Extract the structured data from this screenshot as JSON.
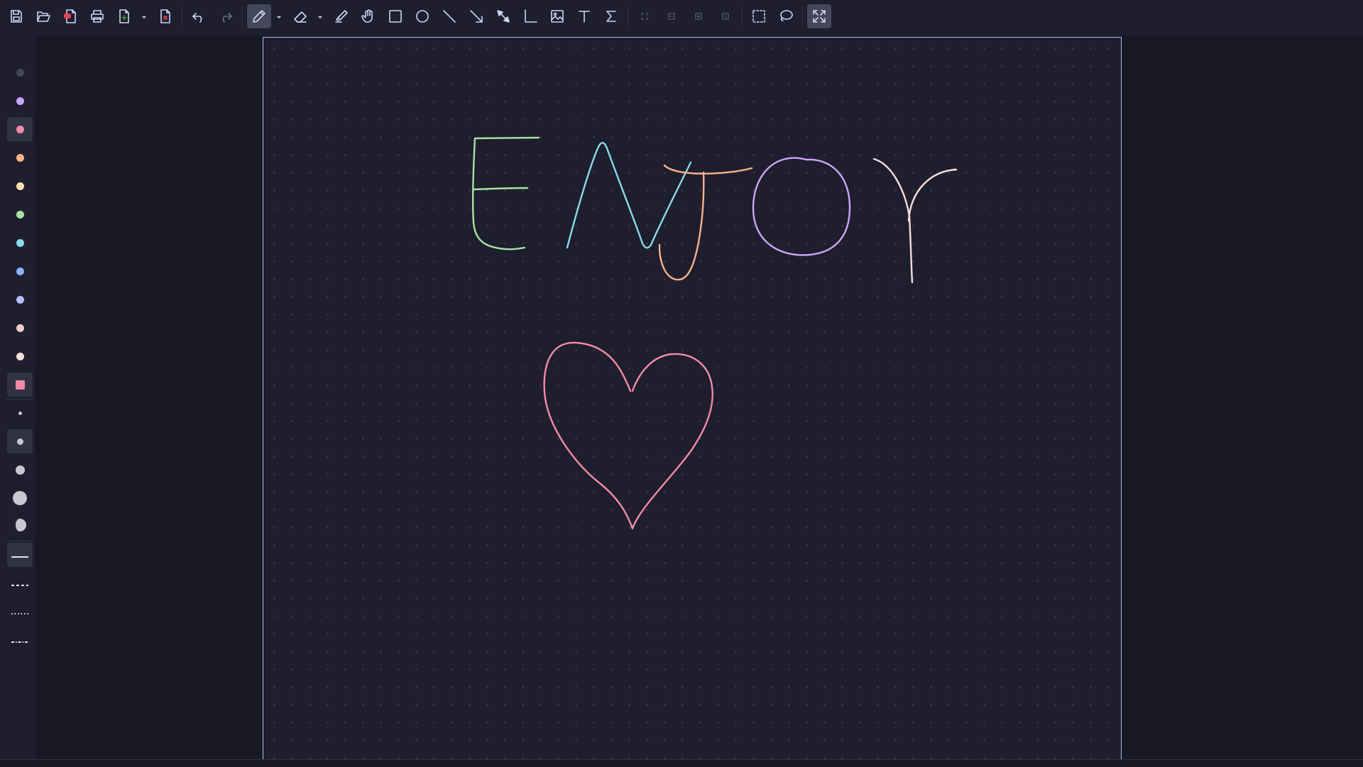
{
  "window": {
    "width": 1920,
    "height": 1080
  },
  "toolbar": {
    "buttons": [
      {
        "name": "save-button",
        "icon": "save-icon"
      },
      {
        "name": "open-button",
        "icon": "folder-open-icon"
      },
      {
        "name": "annotate-pdf-button",
        "icon": "pdf-icon"
      },
      {
        "name": "print-button",
        "icon": "printer-icon"
      },
      {
        "name": "new-page-button",
        "icon": "add-page-icon"
      },
      {
        "name": "delete-page-button",
        "icon": "delete-page-icon"
      },
      {
        "name": "undo-button",
        "icon": "undo-icon"
      },
      {
        "name": "redo-button",
        "icon": "redo-icon"
      },
      {
        "name": "pen-tool-button",
        "icon": "pen-icon",
        "active": true
      },
      {
        "name": "eraser-tool-button",
        "icon": "eraser-icon"
      },
      {
        "name": "highlighter-tool-button",
        "icon": "highlighter-icon"
      },
      {
        "name": "hand-tool-button",
        "icon": "hand-icon"
      },
      {
        "name": "rectangle-tool-button",
        "icon": "rectangle-icon"
      },
      {
        "name": "ellipse-tool-button",
        "icon": "ellipse-icon"
      },
      {
        "name": "line-tool-button",
        "icon": "line-icon"
      },
      {
        "name": "arrow-tool-button",
        "icon": "arrow-icon"
      },
      {
        "name": "double-arrow-tool-button",
        "icon": "double-arrow-icon"
      },
      {
        "name": "axis-tool-button",
        "icon": "axis-icon"
      },
      {
        "name": "image-tool-button",
        "icon": "image-icon"
      },
      {
        "name": "text-tool-button",
        "icon": "text-icon"
      },
      {
        "name": "latex-tool-button",
        "icon": "sigma-icon"
      },
      {
        "name": "zoom-fit-button",
        "icon": "fit-icon"
      },
      {
        "name": "zoom-out-button",
        "icon": "zoom-out-icon"
      },
      {
        "name": "zoom-in-button",
        "icon": "zoom-in-icon"
      },
      {
        "name": "zoom-100-button",
        "icon": "zoom-100-icon"
      },
      {
        "name": "select-rect-button",
        "icon": "select-rect-icon"
      },
      {
        "name": "lasso-select-button",
        "icon": "lasso-icon"
      },
      {
        "name": "fullscreen-button",
        "icon": "fullscreen-icon",
        "active": true
      }
    ]
  },
  "sidebar": {
    "colors": [
      {
        "name": "color-gray",
        "hex": "#45475a",
        "active": false
      },
      {
        "name": "color-mauve",
        "hex": "#cba6f7",
        "active": false
      },
      {
        "name": "color-red",
        "hex": "#f38ba8",
        "active": true
      },
      {
        "name": "color-peach",
        "hex": "#fab387",
        "active": false
      },
      {
        "name": "color-yellow",
        "hex": "#f9e2af",
        "active": false
      },
      {
        "name": "color-green",
        "hex": "#a6e3a1",
        "active": false
      },
      {
        "name": "color-sky",
        "hex": "#89dceb",
        "active": false
      },
      {
        "name": "color-blue",
        "hex": "#89b4fa",
        "active": false
      },
      {
        "name": "color-lavender",
        "hex": "#b4befe",
        "active": false
      },
      {
        "name": "color-flamingo",
        "hex": "#f2cdcd",
        "active": false
      },
      {
        "name": "color-rosewater",
        "hex": "#f5e0dc",
        "active": false
      }
    ],
    "custom_color": {
      "name": "custom-color",
      "hex": "#f38ba8"
    },
    "widths": [
      {
        "name": "width-fine",
        "size": "fine",
        "active": false
      },
      {
        "name": "width-medium",
        "size": "medium",
        "active": true
      },
      {
        "name": "width-thick",
        "size": "thick",
        "active": false
      },
      {
        "name": "width-very-thick",
        "size": "very-thick",
        "active": false
      }
    ],
    "pressure": {
      "name": "pressure-toggle",
      "icon": "pressure-icon"
    },
    "line_styles": [
      {
        "name": "line-style-solid",
        "style": "solid",
        "active": true
      },
      {
        "name": "line-style-dashed",
        "style": "dashed",
        "active": false
      },
      {
        "name": "line-style-dotted",
        "style": "dotted",
        "active": false
      },
      {
        "name": "line-style-dash-dot",
        "style": "dash-dot",
        "active": false
      }
    ]
  },
  "canvas": {
    "page_background": "#1e1e2e",
    "page_border": "#b4befe",
    "grid": "dots",
    "strokes": [
      {
        "name": "stroke-letter-e",
        "color": "#a6e3a1"
      },
      {
        "name": "stroke-letter-n",
        "color": "#89dceb"
      },
      {
        "name": "stroke-letter-j",
        "color": "#fab387"
      },
      {
        "name": "stroke-letter-o",
        "color": "#cba6f7"
      },
      {
        "name": "stroke-letter-y",
        "color": "#f5e0dc"
      },
      {
        "name": "stroke-heart",
        "color": "#f38ba8"
      }
    ]
  }
}
